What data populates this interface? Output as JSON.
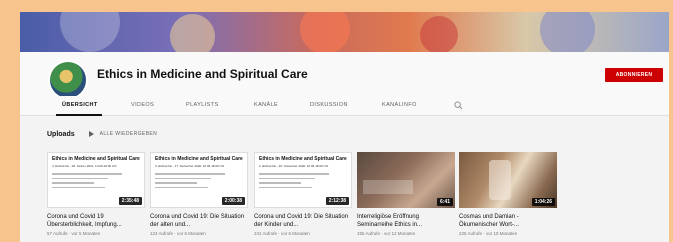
{
  "channel": {
    "name": "Ethics in Medicine and Spiritual Care",
    "subscribe_label": "ABONNIEREN"
  },
  "tabs": [
    {
      "label": "ÜBERSICHT",
      "active": true
    },
    {
      "label": "VIDEOS",
      "active": false
    },
    {
      "label": "PLAYLISTS",
      "active": false
    },
    {
      "label": "KANÄLE",
      "active": false
    },
    {
      "label": "DISKUSSION",
      "active": false
    },
    {
      "label": "KANALINFO",
      "active": false
    }
  ],
  "search_icon": "search-icon",
  "uploads": {
    "title": "Uploads",
    "play_all_label": "ALLE WIEDERGEBEN",
    "videos": [
      {
        "thumb_title": "Ethics in Medicine and Spiritual Care",
        "thumb_sub": "4. Einheit Do., 28. Jänner 2021, 10.00-18.00 Uhr",
        "duration": "2:35:48",
        "title": "Corona und Covid 19 Übersterblichkeit, Impfung...",
        "meta": "57 Aufrufe · vor 5 Monaten",
        "thumb_type": "slide"
      },
      {
        "thumb_title": "Ethics in Medicine and Spiritual Care",
        "thumb_sub": "3. Einheit Do., 17. Dezember 2020, 10.00-18.00 Uhr",
        "duration": "2:00:38",
        "title": "Corona und Covid 19: Die Situation der alten und...",
        "meta": "124 Aufrufe · vor 6 Monaten",
        "thumb_type": "slide"
      },
      {
        "thumb_title": "Ethics in Medicine and Spiritual Care",
        "thumb_sub": "2. Einheit Do., 26. November 2020, 10.00-18.00 Uhr",
        "duration": "2:12:38",
        "title": "Corona und Covid 19: Die Situation der Kinder und...",
        "meta": "241 Aufrufe · vor 6 Monaten",
        "thumb_type": "slide"
      },
      {
        "thumb_title": "",
        "thumb_sub": "",
        "duration": "6:41",
        "title": "Interreligiöse Eröffnung Seminarreihe Ethics in...",
        "meta": "155 Aufrufe · vor 12 Monaten",
        "thumb_type": "photo-dark"
      },
      {
        "thumb_title": "",
        "thumb_sub": "",
        "duration": "1:04:26",
        "title": "Cosmas und Damian - Ökumenischer Wort-...",
        "meta": "225 Aufrufe · vor 10 Monaten",
        "thumb_type": "photo-warm"
      }
    ]
  },
  "colors": {
    "subscribe_red": "#cc0000",
    "page_bg": "#f9f9f9",
    "outer_bg": "#f6c48c"
  }
}
